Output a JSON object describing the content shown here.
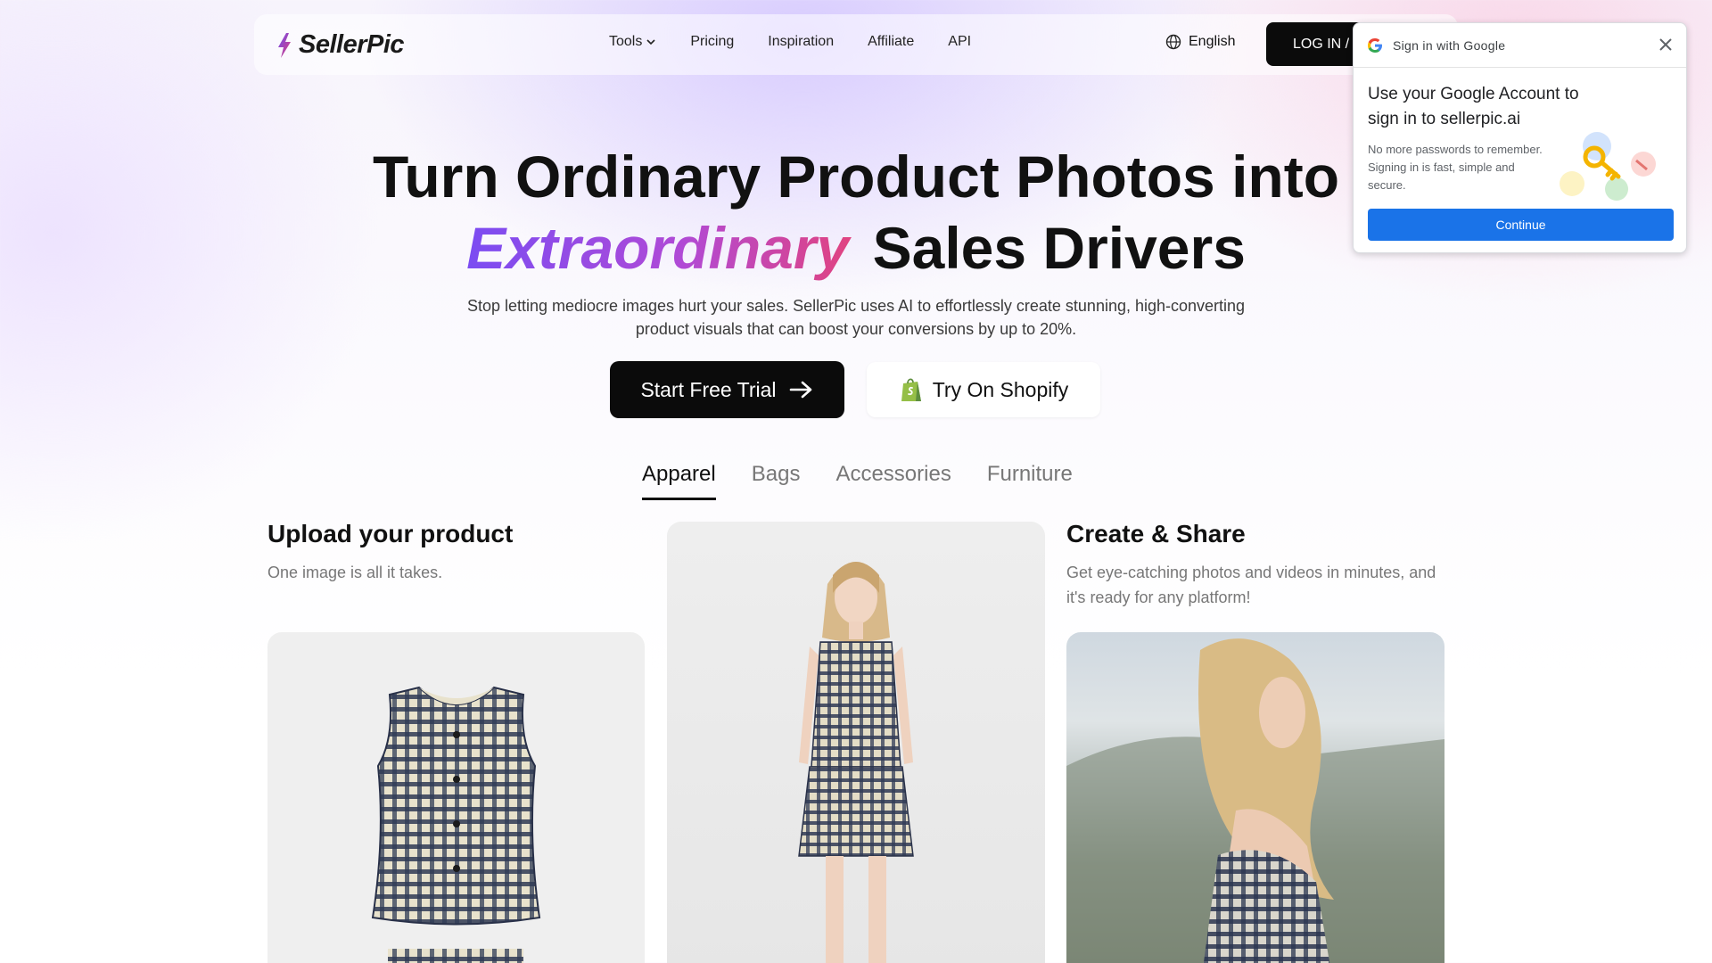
{
  "nav": {
    "logo_text": "SellerPic",
    "links": [
      "Tools",
      "Pricing",
      "Inspiration",
      "Affiliate",
      "API"
    ],
    "language": "English",
    "login_label": "LOG IN / SIGN UP"
  },
  "hero": {
    "title_line1": "Turn Ordinary Product Photos into",
    "title_highlight": "Extraordinary",
    "title_line2_rest": "Sales Drivers",
    "subtitle": "Stop letting mediocre images hurt your sales. SellerPic uses AI to effortlessly create stunning, high-converting product visuals that can boost your conversions by up to 20%.",
    "cta_primary": "Start Free Trial",
    "cta_secondary": "Try On Shopify"
  },
  "tabs": [
    "Apparel",
    "Bags",
    "Accessories",
    "Furniture"
  ],
  "columns": {
    "upload": {
      "title": "Upload your product",
      "desc": "One image is all it takes."
    },
    "share": {
      "title": "Create & Share",
      "desc": "Get eye-catching photos and videos in minutes, and it's ready for any platform!"
    }
  },
  "google_popup": {
    "header": "Sign in with Google",
    "heading": "Use your Google Account to sign in to sellerpic.ai",
    "body": "No more passwords to remember. Signing in is fast, simple and secure.",
    "button": "Continue"
  },
  "colors": {
    "brand_gradient_start": "#7b4cf2",
    "brand_gradient_end": "#e2437e",
    "button_dark": "#0b0b0b",
    "google_blue": "#1a73e8"
  },
  "icons": [
    "sellerpic-logo-icon",
    "chevron-down-icon",
    "globe-icon",
    "arrow-right-icon",
    "shopify-bag-icon",
    "google-g-icon",
    "close-icon",
    "key-illustration-icon"
  ]
}
